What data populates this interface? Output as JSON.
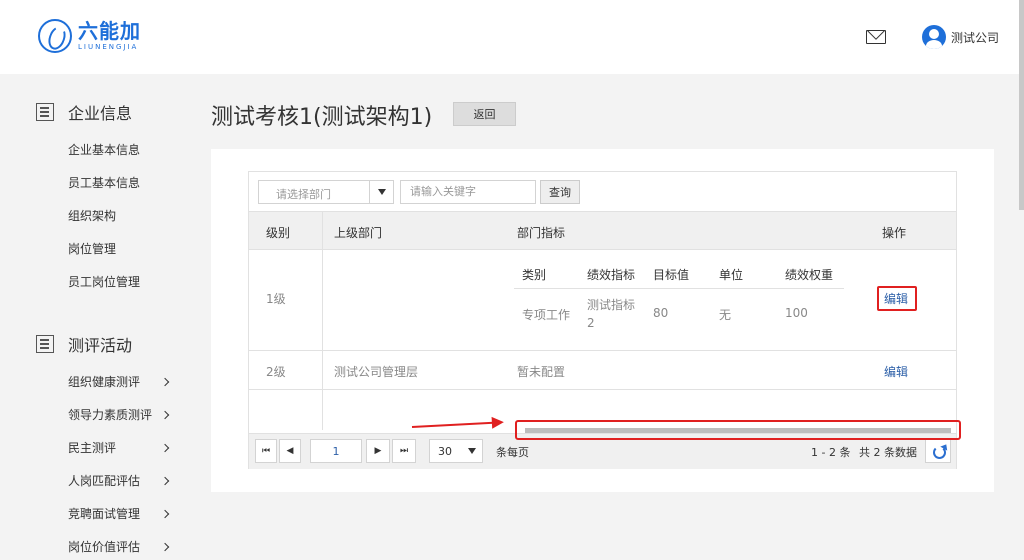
{
  "header": {
    "logo_cn": "六能加",
    "logo_en": "LIUNENGJIA",
    "user_name": "测试公司",
    "icons": [
      "logo-icon",
      "mail-icon",
      "user-avatar-icon"
    ]
  },
  "sidebar": {
    "sections": [
      {
        "title": "企业信息",
        "icon": "building-icon",
        "items": [
          "企业基本信息",
          "员工基本信息",
          "组织架构",
          "岗位管理",
          "员工岗位管理"
        ]
      },
      {
        "title": "测评活动",
        "icon": "clipboard-icon",
        "items": [
          "组织健康测评",
          "领导力素质测评",
          "民主测评",
          "人岗匹配评估",
          "竞聘面试管理",
          "岗位价值评估"
        ]
      }
    ]
  },
  "main": {
    "title": "测试考核1(测试架构1)",
    "back_label": "返回",
    "toolbar": {
      "dept_placeholder": "请选择部门",
      "keyword_placeholder": "请输入关键字",
      "query_label": "查询"
    },
    "table": {
      "columns": [
        "级别",
        "上级部门",
        "部门指标",
        "操作"
      ],
      "sub_columns": [
        "类别",
        "绩效指标",
        "目标值",
        "单位",
        "绩效权重"
      ],
      "rows": [
        {
          "level": "1级",
          "parent": "",
          "indicators": [
            {
              "category": "专项工作",
              "indicator_a": "测试指标",
              "indicator_b": "2",
              "target": "80",
              "unit": "无",
              "weight": "100"
            }
          ],
          "action": "编辑"
        },
        {
          "level": "2级",
          "parent": "测试公司管理层",
          "indicator_text": "暂未配置",
          "action": "编辑"
        }
      ]
    },
    "pager": {
      "first": "⏮",
      "prev": "◀",
      "page": "1",
      "next": "▶",
      "last": "⏭",
      "page_size": "30",
      "per_page_label": "条每页",
      "range": "1 - 2 条",
      "total": "共 2 条数据"
    }
  },
  "colors": {
    "accent": "#1e6fd9",
    "link": "#2c5fa8",
    "highlight": "#e02020"
  }
}
